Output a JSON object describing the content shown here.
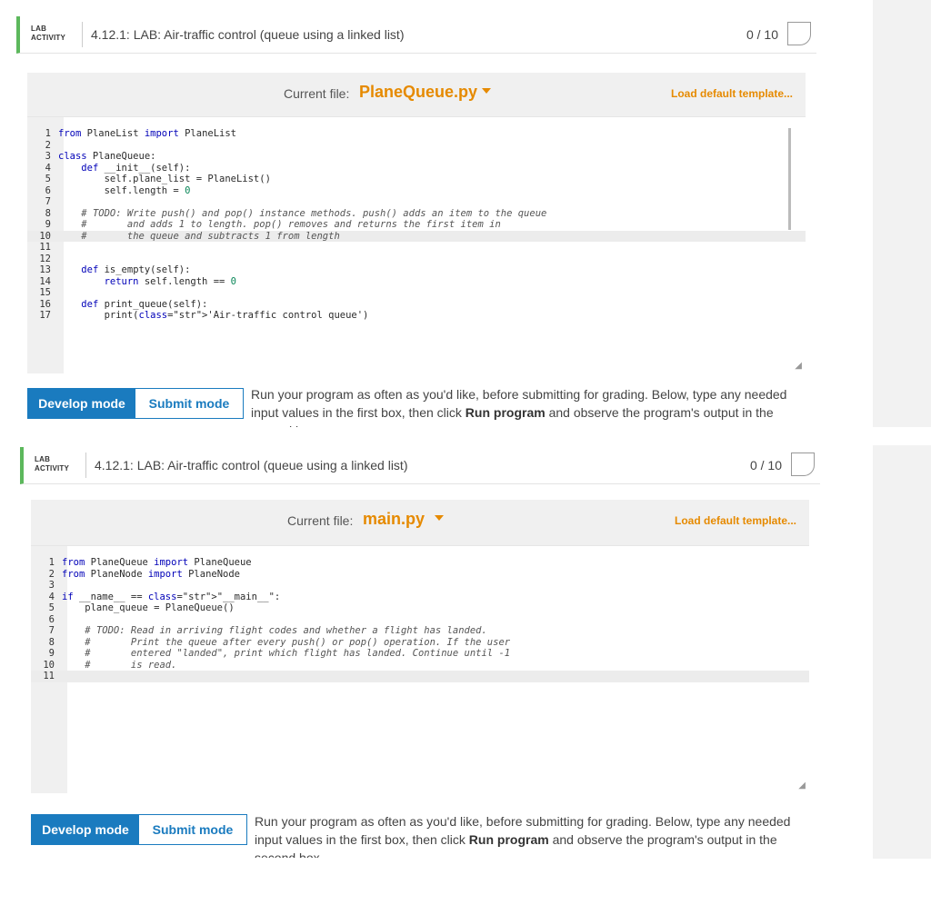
{
  "labs": [
    {
      "tag": "LAB ACTIVITY",
      "title": "4.12.1: LAB: Air-traffic control (queue using a linked list)",
      "score": "0 / 10",
      "file_label": "Current file:",
      "file_name": "PlaneQueue.py",
      "load_template": "Load default template...",
      "code": [
        {
          "n": "1",
          "t": "from PlaneList import PlaneList"
        },
        {
          "n": "2",
          "t": ""
        },
        {
          "n": "3",
          "t": "class PlaneQueue:"
        },
        {
          "n": "4",
          "t": "    def __init__(self):"
        },
        {
          "n": "5",
          "t": "        self.plane_list = PlaneList()"
        },
        {
          "n": "6",
          "t": "        self.length = 0"
        },
        {
          "n": "7",
          "t": ""
        },
        {
          "n": "8",
          "t": "    # TODO: Write push() and pop() instance methods. push() adds an item to the queue"
        },
        {
          "n": "9",
          "t": "    #       and adds 1 to length. pop() removes and returns the first item in"
        },
        {
          "n": "10",
          "t": "    #       the queue and subtracts 1 from length"
        },
        {
          "n": "11",
          "t": ""
        },
        {
          "n": "12",
          "t": ""
        },
        {
          "n": "13",
          "t": "    def is_empty(self):"
        },
        {
          "n": "14",
          "t": "        return self.length == 0"
        },
        {
          "n": "15",
          "t": ""
        },
        {
          "n": "16",
          "t": "    def print_queue(self):"
        },
        {
          "n": "17",
          "t": "        print('Air-traffic control queue')"
        }
      ],
      "active_line": 9,
      "develop_mode": "Develop mode",
      "submit_mode": "Submit mode",
      "desc_1": "Run your program as often as you'd like, before submitting for grading. Below, type any needed input values in the first box, then click ",
      "desc_bold": "Run program",
      "desc_2": " and observe the program's output in the second box."
    },
    {
      "tag": "LAB ACTIVITY",
      "title": "4.12.1: LAB: Air-traffic control (queue using a linked list)",
      "score": "0 / 10",
      "file_label": "Current file:",
      "file_name": "main.py",
      "load_template": "Load default template...",
      "code": [
        {
          "n": "1",
          "t": "from PlaneQueue import PlaneQueue"
        },
        {
          "n": "2",
          "t": "from PlaneNode import PlaneNode"
        },
        {
          "n": "3",
          "t": ""
        },
        {
          "n": "4",
          "t": "if __name__ == \"__main__\":"
        },
        {
          "n": "5",
          "t": "    plane_queue = PlaneQueue()"
        },
        {
          "n": "6",
          "t": ""
        },
        {
          "n": "7",
          "t": "    # TODO: Read in arriving flight codes and whether a flight has landed."
        },
        {
          "n": "8",
          "t": "    #       Print the queue after every push() or pop() operation. If the user"
        },
        {
          "n": "9",
          "t": "    #       entered \"landed\", print which flight has landed. Continue until -1"
        },
        {
          "n": "10",
          "t": "    #       is read."
        },
        {
          "n": "11",
          "t": ""
        }
      ],
      "active_line": 10,
      "develop_mode": "Develop mode",
      "submit_mode": "Submit mode",
      "desc_1": "Run your program as often as you'd like, before submitting for grading. Below, type any needed input values in the first box, then click ",
      "desc_bold": "Run program",
      "desc_2": " and observe the program's output in the second box."
    }
  ],
  "colors": {
    "accent": "#e68a00",
    "primary": "#1a7bbf",
    "lab_border": "#5cb85c"
  }
}
